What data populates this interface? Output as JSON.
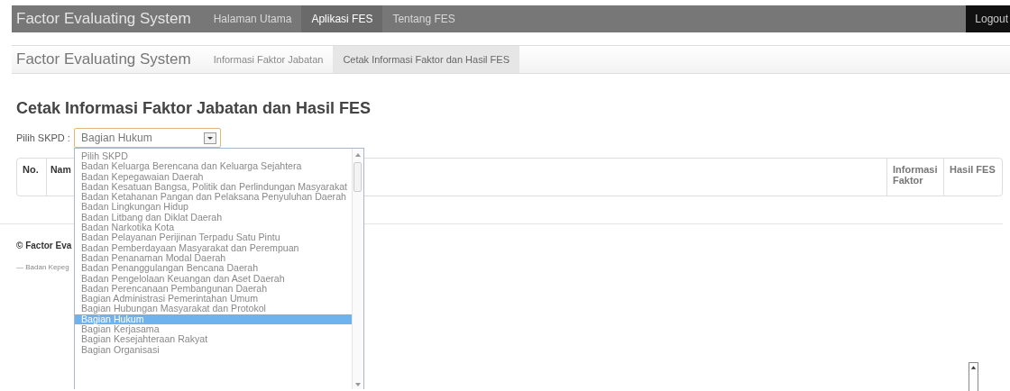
{
  "top_nav": {
    "brand": "Factor Evaluating System",
    "items": [
      {
        "label": "Halaman Utama",
        "selected": false
      },
      {
        "label": "Aplikasi FES",
        "selected": true
      },
      {
        "label": "Tentang FES",
        "selected": false
      }
    ],
    "logout": "Logout"
  },
  "sub_nav": {
    "brand": "Factor Evaluating System",
    "items": [
      {
        "label": "Informasi Faktor Jabatan",
        "selected": false
      },
      {
        "label": "Cetak Informasi Faktor dan Hasil FES",
        "selected": true
      }
    ]
  },
  "heading": "Cetak Informasi Faktor Jabatan dan Hasil FES",
  "filter": {
    "label": "Pilih SKPD :",
    "value": "Bagian Hukum",
    "expanded": true,
    "options": [
      {
        "label": "Pilih SKPD",
        "selected": false
      },
      {
        "label": "Badan Keluarga Berencana dan Keluarga Sejahtera",
        "selected": false
      },
      {
        "label": "Badan Kepegawaian Daerah",
        "selected": false
      },
      {
        "label": "Badan Kesatuan Bangsa, Politik dan Perlindungan Masyarakat",
        "selected": false
      },
      {
        "label": "Badan Ketahanan Pangan dan Pelaksana Penyuluhan Daerah",
        "selected": false
      },
      {
        "label": "Badan Lingkungan Hidup",
        "selected": false
      },
      {
        "label": "Badan Litbang dan Diklat Daerah",
        "selected": false
      },
      {
        "label": "Badan Narkotika Kota",
        "selected": false
      },
      {
        "label": "Badan Pelayanan Perijinan Terpadu Satu Pintu",
        "selected": false
      },
      {
        "label": "Badan Pemberdayaan Masyarakat dan Perempuan",
        "selected": false
      },
      {
        "label": "Badan Penanaman Modal Daerah",
        "selected": false
      },
      {
        "label": "Badan Penanggulangan Bencana Daerah",
        "selected": false
      },
      {
        "label": "Badan Pengelolaan Keuangan dan Aset Daerah",
        "selected": false
      },
      {
        "label": "Badan Perencanaan Pembangunan Daerah",
        "selected": false
      },
      {
        "label": "Bagian Administrasi Pemerintahan Umum",
        "selected": false
      },
      {
        "label": "Bagian Hubungan Masyarakat dan Protokol",
        "selected": false
      },
      {
        "label": "Bagian Hukum",
        "selected": true
      },
      {
        "label": "Bagian Kerjasama",
        "selected": false
      },
      {
        "label": "Bagian Kesejahteraan Rakyat",
        "selected": false
      },
      {
        "label": "Bagian Organisasi",
        "selected": false
      }
    ]
  },
  "table": {
    "columns": [
      "No.",
      "Nam",
      "Informasi Faktor",
      "Hasil FES"
    ]
  },
  "footer": {
    "copyright": "© Factor Eva",
    "note": "— Badan Kepeg"
  }
}
